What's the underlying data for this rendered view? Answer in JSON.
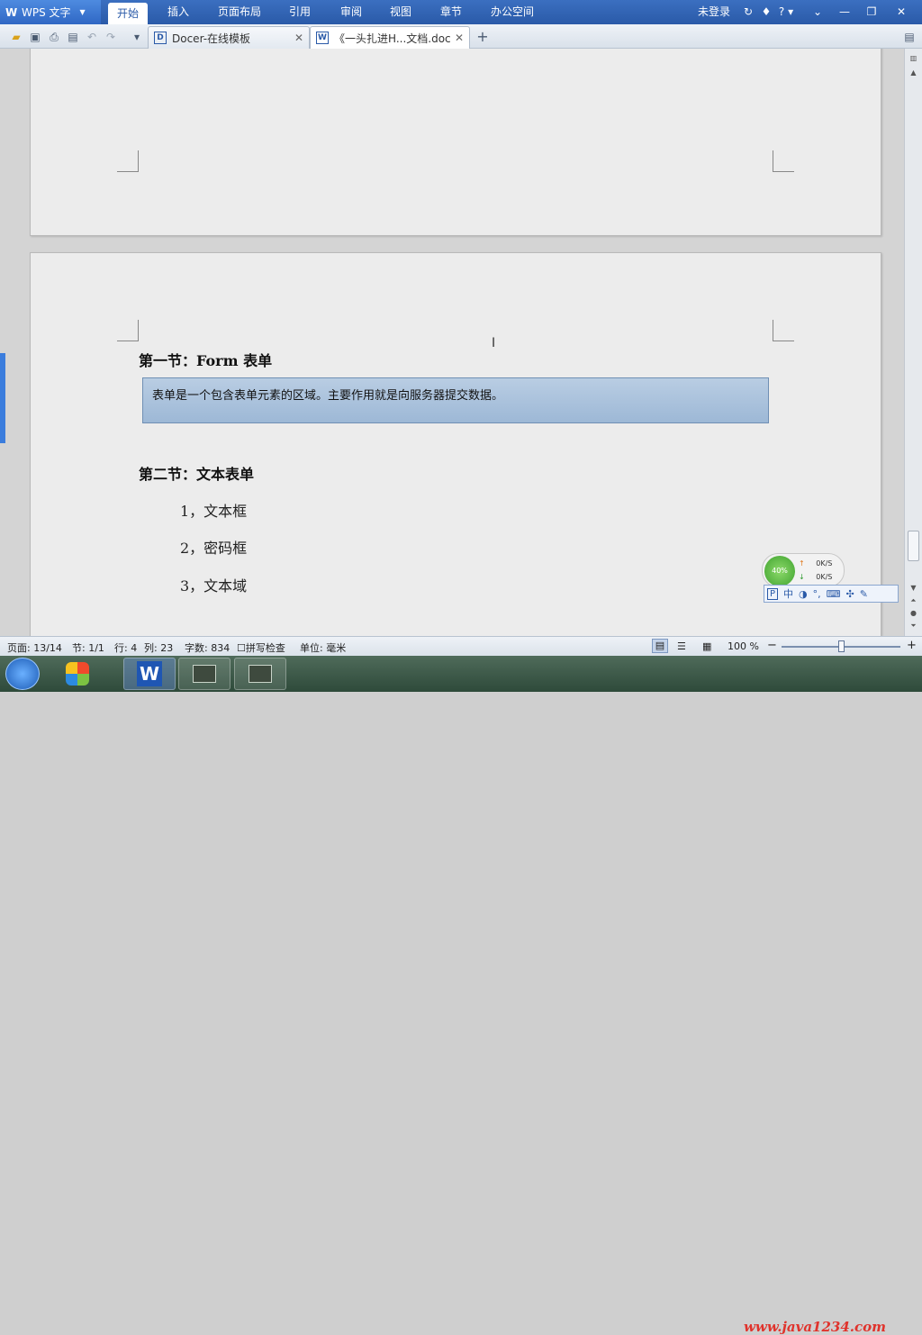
{
  "app": {
    "logo_text": "WPS 文字",
    "logo_letter": "W"
  },
  "menu": {
    "items": [
      "开始",
      "插入",
      "页面布局",
      "引用",
      "审阅",
      "视图",
      "章节",
      "办公空间"
    ],
    "login": "未登录",
    "help": "?"
  },
  "tabs": [
    {
      "label": "Docer-在线模板",
      "close": "✕"
    },
    {
      "label": "《一头扎进H...文档.doc",
      "close": "✕"
    }
  ],
  "add_tab": "+",
  "document": {
    "section1_title": "第一节：Form 表单",
    "note": "表单是一个包含表单元素的区域。主要作用就是向服务器提交数据。",
    "section2_title": "第二节：文本表单",
    "list": [
      "1，文本框",
      "2，密码框",
      "3，文本域"
    ]
  },
  "net_widget": {
    "percent": "40%",
    "up": "0K/S",
    "down": "0K/S"
  },
  "ime": {
    "mode": "中"
  },
  "status": {
    "page": "页面: 13/14",
    "section": "节: 1/1",
    "row": "行: 4",
    "col": "列: 23",
    "words": "字数: 834",
    "spell": "拼写检查",
    "unit": "单位: 毫米",
    "zoom": "100 %",
    "zoom_minus": "−",
    "zoom_plus": "+"
  },
  "taskbar": {
    "wps_letter": "W",
    "watermark": "www.java1234.com"
  },
  "colors": {
    "menubar": "#2a5aa8",
    "note_box": "#a9c2de",
    "accent": "#3b7ddd"
  }
}
